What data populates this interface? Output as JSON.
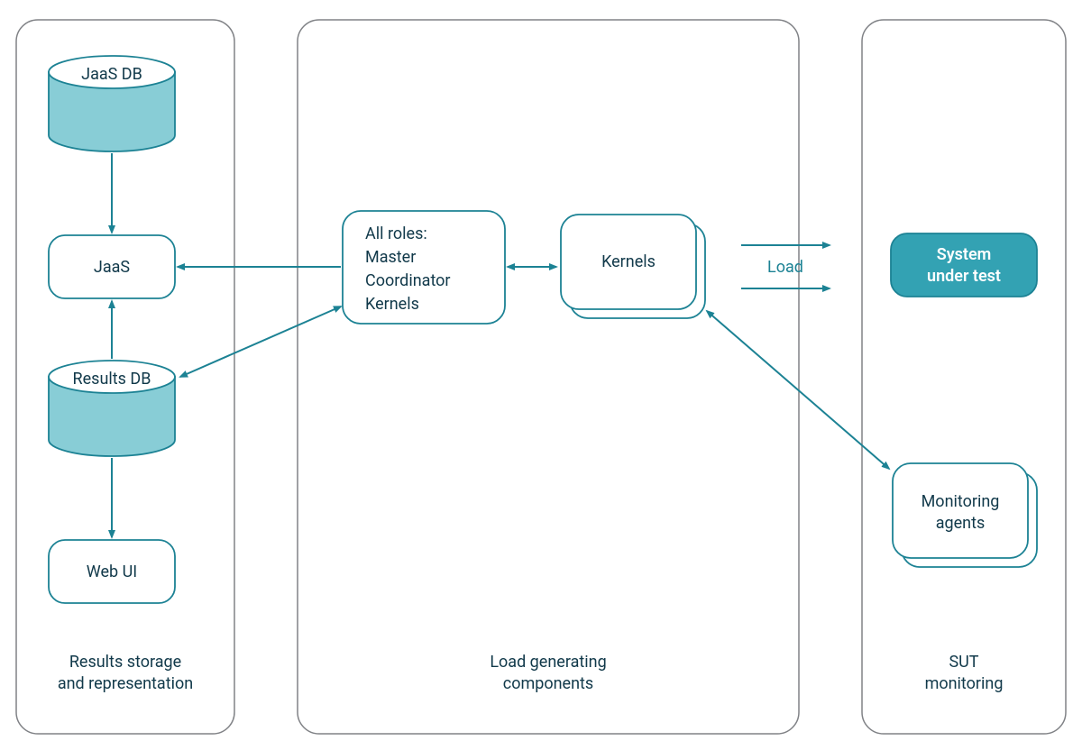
{
  "columns": {
    "left": {
      "caption_line1": "Results storage",
      "caption_line2": "and representation"
    },
    "middle": {
      "caption_line1": "Load generating",
      "caption_line2": "components"
    },
    "right": {
      "caption_line1": "SUT",
      "caption_line2": "monitoring"
    }
  },
  "nodes": {
    "jaas_db": "JaaS DB",
    "jaas": "JaaS",
    "results_db": "Results DB",
    "web_ui": "Web UI",
    "allroles_title": "All roles:",
    "allroles_l1": "Master",
    "allroles_l2": "Coordinator",
    "allroles_l3": "Kernels",
    "kernels": "Kernels",
    "sut_l1": "System",
    "sut_l2": "under test",
    "mon_l1": "Monitoring",
    "mon_l2": "agents",
    "load_label": "Load"
  },
  "colors": {
    "teal": "#1c8294",
    "teal_fill": "#33a2b3",
    "teal_light": "#88cdd6",
    "text": "#11394a",
    "border": "#808286"
  }
}
